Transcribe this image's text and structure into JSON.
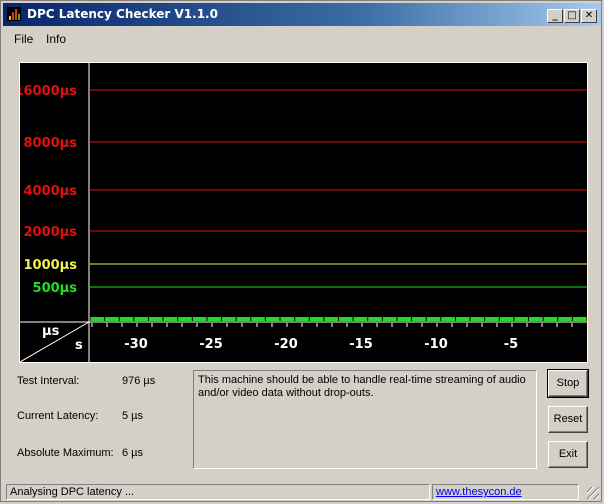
{
  "window": {
    "title": "DPC Latency Checker V1.1.0"
  },
  "menu": [
    {
      "label": "File"
    },
    {
      "label": "Info"
    }
  ],
  "graph": {
    "y_labels": [
      {
        "text": "16000µs",
        "color": "#e01010"
      },
      {
        "text": "8000µs",
        "color": "#e01010"
      },
      {
        "text": "4000µs",
        "color": "#e01010"
      },
      {
        "text": "2000µs",
        "color": "#e01010"
      },
      {
        "text": "1000µs",
        "color": "#f0f050"
      },
      {
        "text": "500µs",
        "color": "#20e020"
      }
    ],
    "corner_top": "µs",
    "corner_bottom": "s",
    "x_labels": [
      "-30",
      "-25",
      "-20",
      "-15",
      "-10",
      "-5"
    ],
    "bar_color": "#22dd22"
  },
  "chart_data": {
    "type": "bar",
    "x": [
      -33,
      -32,
      -31,
      -30,
      -29,
      -28,
      -27,
      -26,
      -25,
      -24,
      -23,
      -22,
      -21,
      -20,
      -19,
      -18,
      -17,
      -16,
      -15,
      -14,
      -13,
      -12,
      -11,
      -10,
      -9,
      -8,
      -7,
      -6,
      -5,
      -4,
      -3,
      -2,
      -1,
      0
    ],
    "values": [
      5,
      5,
      5,
      5,
      5,
      5,
      5,
      5,
      5,
      5,
      5,
      5,
      5,
      5,
      5,
      5,
      5,
      5,
      5,
      5,
      5,
      5,
      5,
      5,
      5,
      5,
      5,
      5,
      5,
      5,
      5,
      5,
      5,
      5
    ],
    "y_ticks": [
      500,
      1000,
      2000,
      4000,
      8000,
      16000
    ],
    "y_scale": "log"
  },
  "info": {
    "test_interval_label": "Test Interval:",
    "test_interval_value": "976 µs",
    "current_latency_label": "Current Latency:",
    "current_latency_value": "5 µs",
    "absolute_maximum_label": "Absolute Maximum:",
    "absolute_maximum_value": "6 µs"
  },
  "message": "This machine should be able to handle real-time streaming of audio and/or video data without drop-outs.",
  "buttons": {
    "stop": "Stop",
    "reset": "Reset",
    "exit": "Exit"
  },
  "status": {
    "text": "Analysing DPC latency ...",
    "link": "www.thesycon.de"
  }
}
